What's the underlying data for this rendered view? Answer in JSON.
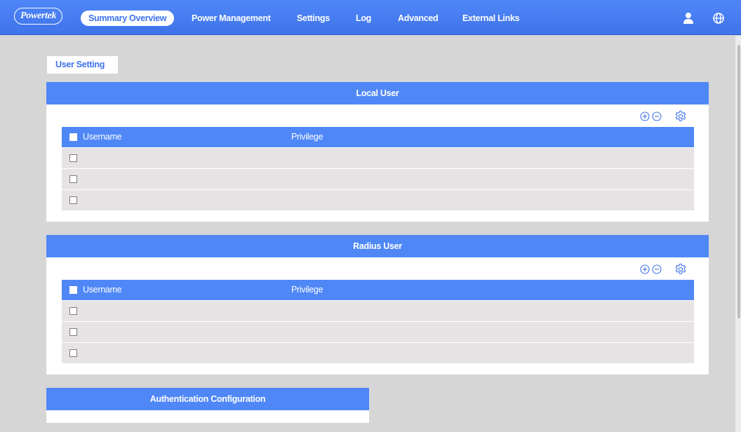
{
  "brand": {
    "logo_text": "Powertek"
  },
  "nav": {
    "items": [
      {
        "label": "Summary Overview",
        "active": true
      },
      {
        "label": "Power Management"
      },
      {
        "label": "Settings"
      },
      {
        "label": "Log"
      },
      {
        "label": "Advanced"
      },
      {
        "label": "External Links"
      }
    ],
    "icons": [
      "user-icon",
      "globe-icon"
    ]
  },
  "page": {
    "tab_label": "User Setting"
  },
  "local_user": {
    "title": "Local User",
    "columns": [
      "Username",
      "Privilege"
    ],
    "rows": [
      {
        "username": "",
        "privilege": ""
      },
      {
        "username": "",
        "privilege": ""
      },
      {
        "username": "",
        "privilege": ""
      }
    ],
    "tools": [
      "add-icon",
      "remove-icon",
      "settings-icon"
    ]
  },
  "radius_user": {
    "title": "Radius User",
    "columns": [
      "Username",
      "Privilege"
    ],
    "rows": [
      {
        "username": "",
        "privilege": ""
      },
      {
        "username": "",
        "privilege": ""
      },
      {
        "username": "",
        "privilege": ""
      }
    ],
    "tools": [
      "add-icon",
      "remove-icon",
      "settings-icon"
    ]
  },
  "auth_config": {
    "title": "Authentication Configuration"
  },
  "colors": {
    "accent": "#4f87f7",
    "background": "#d6d6d6",
    "row": "#e7e3e4"
  }
}
